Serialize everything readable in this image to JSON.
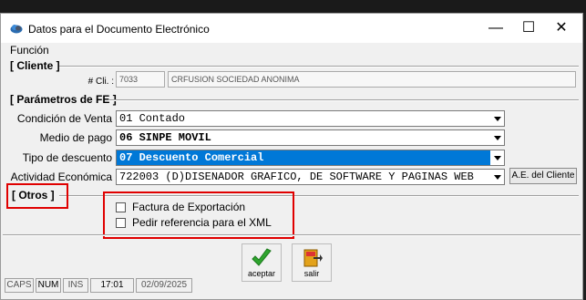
{
  "window": {
    "title": "Datos para el Documento Electrónico",
    "minimize_glyph": "—",
    "maximize_glyph": "☐",
    "close_glyph": "✕"
  },
  "menu": {
    "items": [
      "Función"
    ]
  },
  "cliente": {
    "section_label": "[ Cliente ]",
    "num_label": "# Cli. :",
    "num_value": "7033",
    "name_value": "CRFUSION SOCIEDAD ANONIMA"
  },
  "fe": {
    "section_label": "[ Parámetros de FE ]",
    "condicion": {
      "label": "Condición de Venta",
      "value": "01 Contado"
    },
    "medio": {
      "label": "Medio de pago",
      "value": "06 SINPE MOVIL"
    },
    "descuento": {
      "label": "Tipo de descuento",
      "value": "07 Descuento Comercial"
    },
    "actividad": {
      "label": "Actividad Económica",
      "value": "722003 (D)DISENADOR GRAFICO, DE SOFTWARE Y PAGINAS WEB"
    },
    "ae_button": "A.E. del Cliente"
  },
  "otros": {
    "section_label": "[ Otros ]",
    "exportacion": {
      "label": "Factura de Exportación",
      "checked": false
    },
    "referencia": {
      "label": "Pedir referencia para el XML",
      "checked": false
    }
  },
  "buttons": {
    "aceptar": "aceptar",
    "salir": "salir"
  },
  "status": {
    "caps": "CAPS",
    "num": "NUM",
    "ins": "INS",
    "time": "17:01",
    "date": "02/09/2025"
  },
  "colors": {
    "selection": "#0078d7",
    "highlight": "#e00000",
    "check_green": "#2fa52f"
  }
}
